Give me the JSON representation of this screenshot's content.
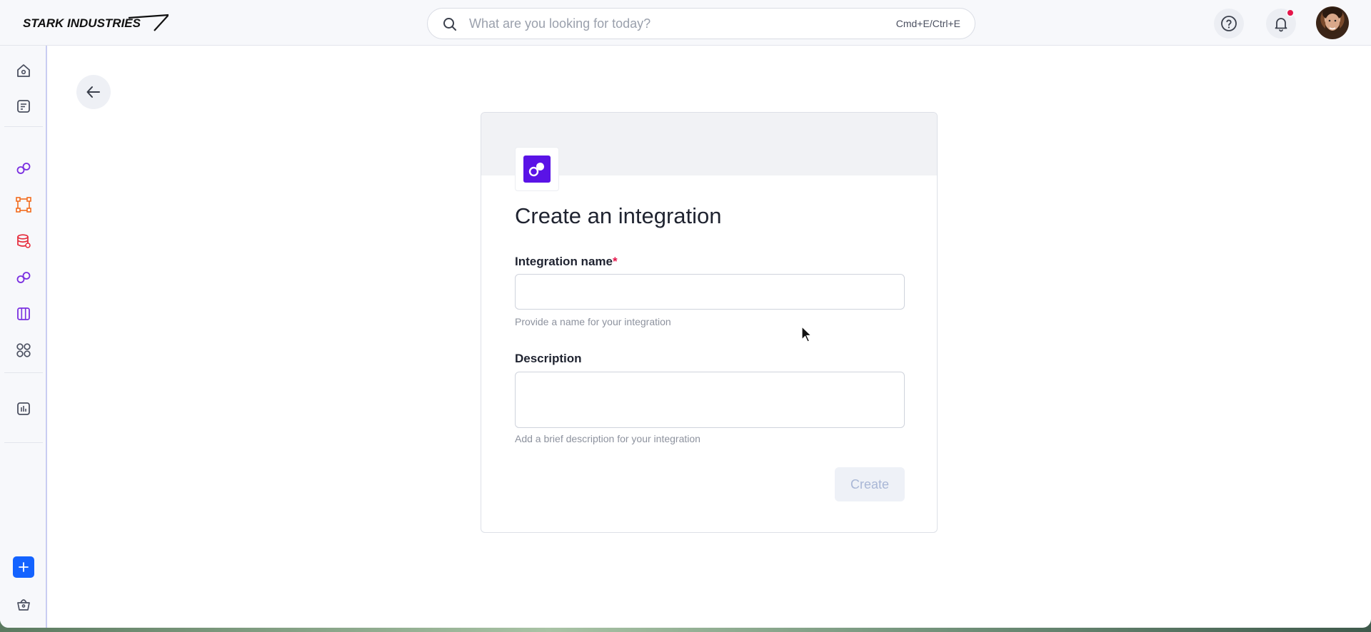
{
  "brand": {
    "logo_text": "STARK INDUSTRIES"
  },
  "search": {
    "placeholder": "What are you looking for today?",
    "shortcut": "Cmd+E/Ctrl+E"
  },
  "topbar": {
    "help_icon": "help-circle-icon",
    "notification_icon": "bell-icon",
    "notification_dot_color": "#e5154a"
  },
  "sidebar": {
    "items": [
      {
        "name": "home",
        "icon": "home-icon",
        "color": "#4b5060"
      },
      {
        "name": "notes",
        "icon": "notes-icon",
        "color": "#4b5060"
      },
      {
        "name": "integrations",
        "icon": "link-icon",
        "color": "#7a2fe0"
      },
      {
        "name": "flows",
        "icon": "nodes-icon",
        "color": "#f26b1d"
      },
      {
        "name": "data",
        "icon": "database-icon",
        "color": "#e52a3a"
      },
      {
        "name": "connections",
        "icon": "link-icon",
        "color": "#7a2fe0"
      },
      {
        "name": "boards",
        "icon": "columns-icon",
        "color": "#7a2fe0"
      },
      {
        "name": "apps",
        "icon": "grid-icon",
        "color": "#4b5060"
      },
      {
        "name": "analytics",
        "icon": "chart-icon",
        "color": "#4b5060"
      }
    ],
    "add_icon": "plus-icon",
    "marketplace_icon": "basket-icon"
  },
  "card": {
    "title": "Create an integration",
    "name_label": "Integration name",
    "required_mark": "*",
    "name_value": "",
    "name_helper": "Provide a name for your integration",
    "description_label": "Description",
    "description_value": "",
    "description_helper": "Add a brief description for your integration",
    "create_label": "Create",
    "logo_color": "#5a13e6"
  },
  "colors": {
    "accent": "#1463ff",
    "sidebar_border": "#c9cdf2"
  }
}
